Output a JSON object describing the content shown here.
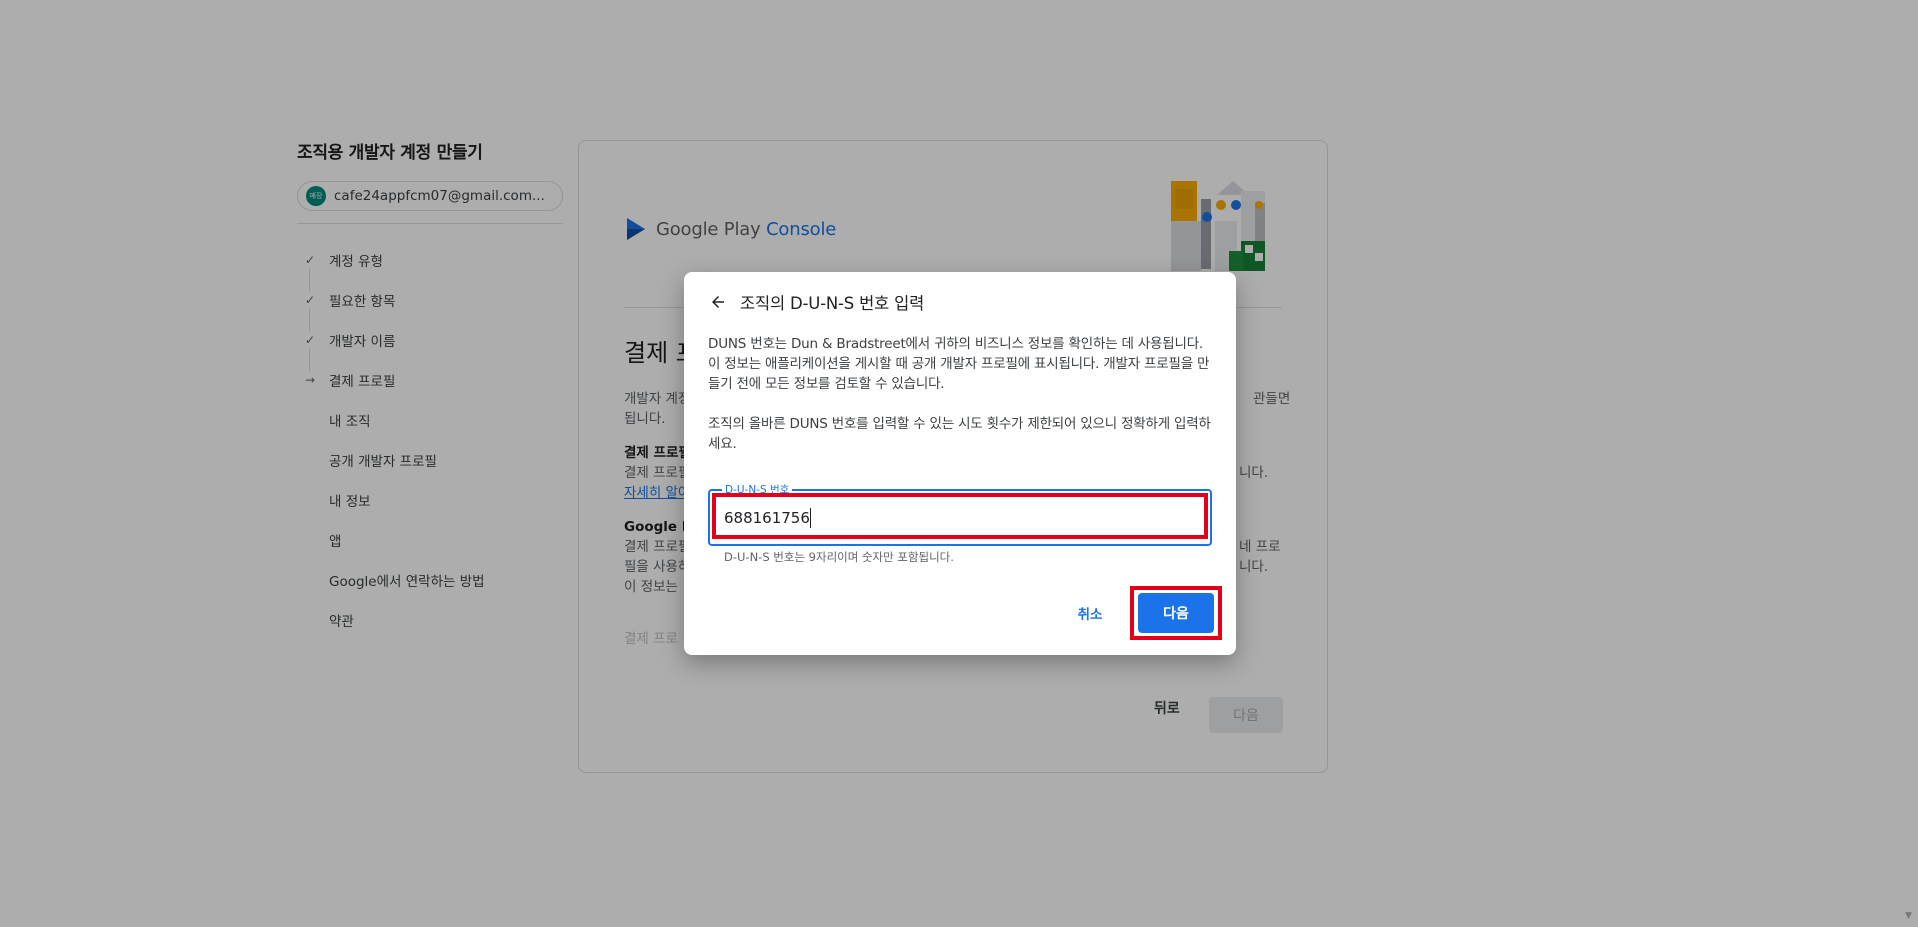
{
  "sidebar": {
    "heading": "조직용 개발자 계정 만들기",
    "account": {
      "avatar_text": "매장",
      "email": "cafe24appfcm07@gmail.com..."
    },
    "steps": [
      {
        "label": "계정 유형",
        "state": "done"
      },
      {
        "label": "필요한 항목",
        "state": "done"
      },
      {
        "label": "개발자 이름",
        "state": "done"
      },
      {
        "label": "결제 프로필",
        "state": "current"
      },
      {
        "label": "내 조직",
        "state": "todo"
      },
      {
        "label": "공개 개발자 프로필",
        "state": "todo"
      },
      {
        "label": "내 정보",
        "state": "todo"
      },
      {
        "label": "앱",
        "state": "todo"
      },
      {
        "label": "Google에서 연락하는 방법",
        "state": "todo"
      },
      {
        "label": "약관",
        "state": "todo"
      }
    ]
  },
  "card": {
    "logo_google_play": "Google Play ",
    "logo_console": "Console",
    "heading": "결제 프",
    "para1_line1": "개발자 계정",
    "para1_line1_end": "관들면",
    "para1_line2": "됩니다.",
    "section1_bold": "결제 프로필",
    "section1_line": "결제 프로필",
    "section1_line_end": "니다.",
    "learn_more": "자세히 알아",
    "section2_bold": "Google P",
    "section2_line1": "결제 프로필",
    "section2_line1_end": "네 프로",
    "section2_line2": "필을 사용하",
    "section2_line2_end": "니다.",
    "section2_line3": "이 정보는",
    "faded_text": "결제 프로",
    "back_label": "뒤로",
    "next_label": "다음"
  },
  "dialog": {
    "title": "조직의 D-U-N-S 번호 입력",
    "paragraph1": "DUNS 번호는 Dun & Bradstreet에서 귀하의 비즈니스 정보를 확인하는 데 사용됩니다. 이 정보는 애플리케이션을 게시할 때 공개 개발자 프로필에 표시됩니다. 개발자 프로필을 만들기 전에 모든 정보를 검토할 수 있습니다.",
    "paragraph2": "조직의 올바른 DUNS 번호를 입력할 수 있는 시도 횟수가 제한되어 있으니 정확하게 입력하세요.",
    "field_label": "D-U-N-S 번호",
    "field_value": "688161756",
    "helper_text": "D-U-N-S 번호는 9자리이며 숫자만 포함됩니다.",
    "cancel_label": "취소",
    "next_label": "다음"
  },
  "colors": {
    "accent": "#1a73e8",
    "highlight": "#e2001a",
    "avatar": "#00897b"
  }
}
